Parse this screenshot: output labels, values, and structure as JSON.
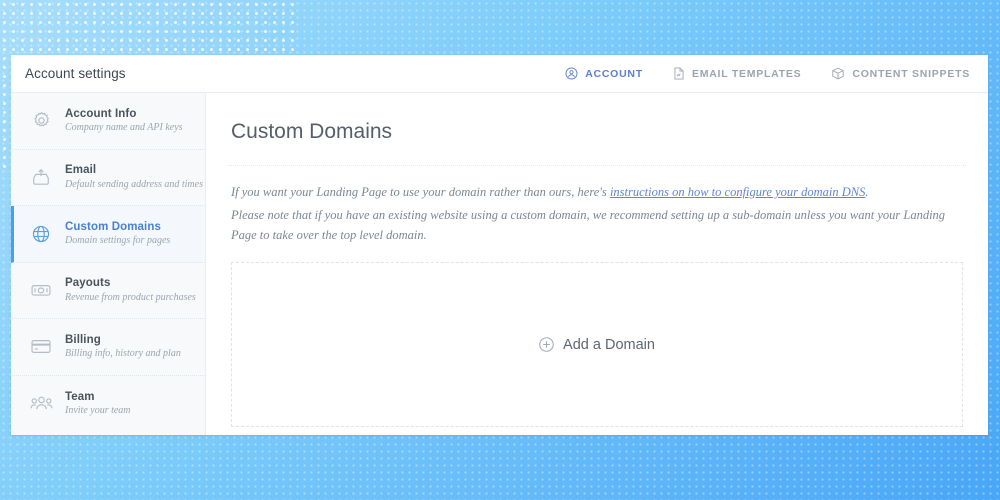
{
  "header": {
    "title": "Account settings",
    "nav": [
      {
        "label": "ACCOUNT",
        "icon": "account-circle-icon",
        "active": true
      },
      {
        "label": "EMAIL TEMPLATES",
        "icon": "document-icon",
        "active": false
      },
      {
        "label": "CONTENT SNIPPETS",
        "icon": "box-icon",
        "active": false
      }
    ]
  },
  "sidebar": {
    "items": [
      {
        "title": "Account Info",
        "subtitle": "Company name and API keys",
        "icon": "gear-icon",
        "active": false
      },
      {
        "title": "Email",
        "subtitle": "Default sending address and times",
        "icon": "outbox-icon",
        "active": false
      },
      {
        "title": "Custom Domains",
        "subtitle": "Domain settings for pages",
        "icon": "globe-icon",
        "active": true
      },
      {
        "title": "Payouts",
        "subtitle": "Revenue from product purchases",
        "icon": "banknote-icon",
        "active": false
      },
      {
        "title": "Billing",
        "subtitle": "Billing info, history and plan",
        "icon": "credit-card-icon",
        "active": false
      },
      {
        "title": "Team",
        "subtitle": "Invite your team",
        "icon": "people-icon",
        "active": false
      }
    ]
  },
  "main": {
    "page_title": "Custom Domains",
    "paragraph_1_before_link": "If you want your Landing Page to use your domain rather than ours, here's ",
    "paragraph_1_link": "instructions on how to configure your domain DNS",
    "paragraph_1_after_link": ".",
    "paragraph_2": "Please note that if you have an existing website using a custom domain, we recommend setting up a sub-domain unless you want your Landing Page to take over the top level domain.",
    "add_domain_label": "Add a Domain",
    "add_domain_icon": "plus-circle-icon"
  },
  "colors": {
    "accent_blue": "#4a9df0",
    "link_blue": "#5b87d8",
    "nav_active": "#5b7fd4",
    "text_dark": "#3d4852",
    "text_muted": "#9ba5b0",
    "card_bg": "#ffffff",
    "sidebar_bg": "#f7f9fb",
    "background_gradient_from": "#a8ddfb",
    "background_gradient_to": "#49a6f7"
  }
}
